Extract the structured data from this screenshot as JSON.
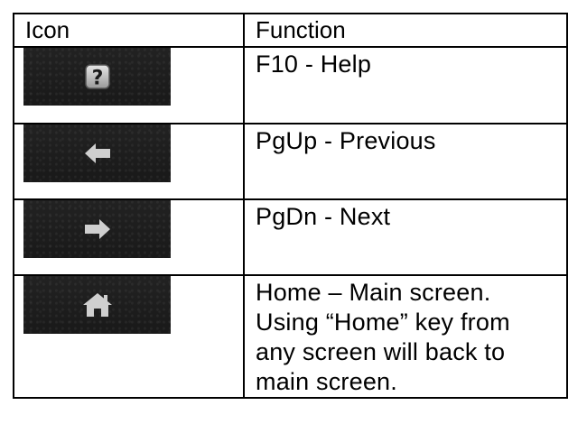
{
  "table": {
    "header": {
      "icon": "Icon",
      "function": "Function"
    },
    "rows": [
      {
        "icon": "help-icon",
        "function": "F10 - Help"
      },
      {
        "icon": "left-arrow-icon",
        "function": "PgUp - Previous"
      },
      {
        "icon": "right-arrow-icon",
        "function": "PgDn - Next"
      },
      {
        "icon": "home-icon",
        "function_lines": [
          "Home – Main screen.",
          "Using “Home” key from",
          "any screen will back to",
          "main screen."
        ]
      }
    ]
  },
  "colors": {
    "icon_background": "#1d1d1d",
    "icon_fill": "#c8c8c8",
    "border": "#000000"
  }
}
